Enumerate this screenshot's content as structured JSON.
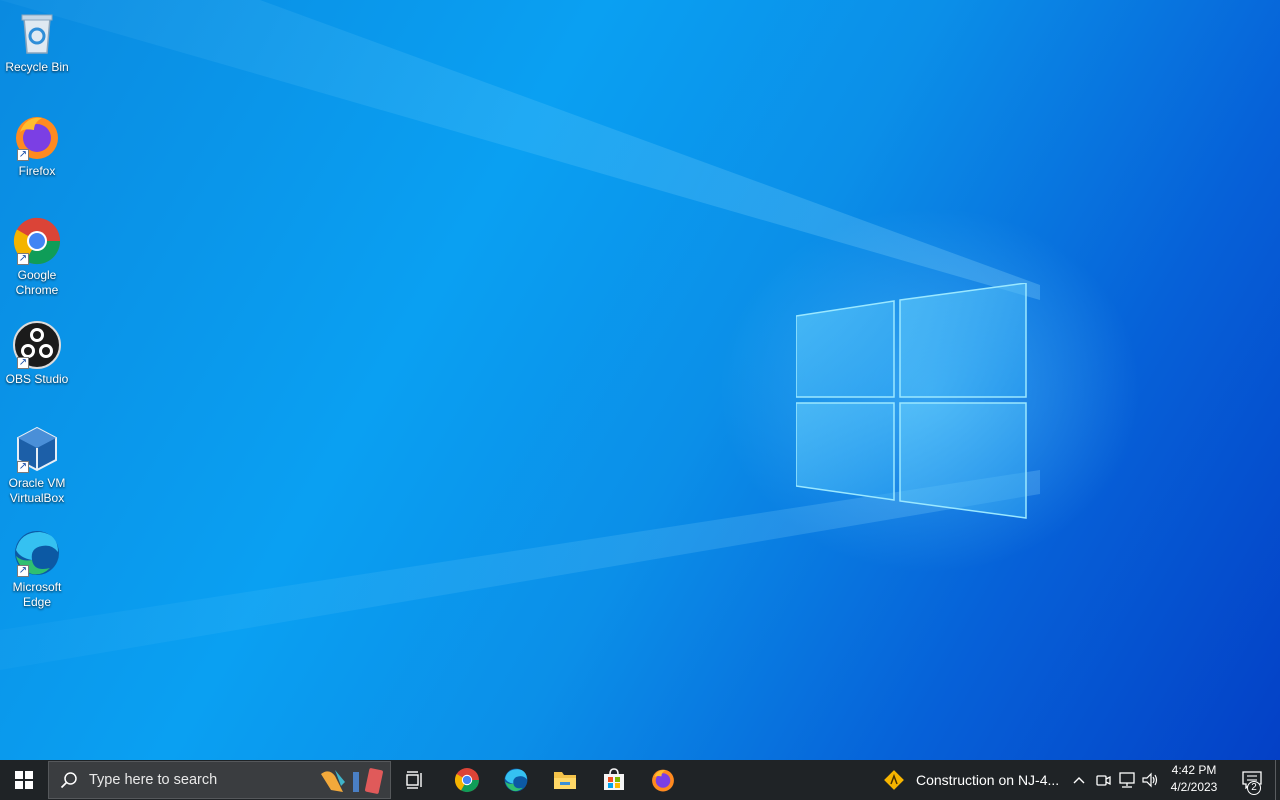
{
  "desktop": {
    "icons": [
      {
        "label": "Recycle Bin",
        "icon": "recycle-bin-icon",
        "shortcut": false
      },
      {
        "label": "Firefox",
        "icon": "firefox-icon",
        "shortcut": true
      },
      {
        "label": "Google\nChrome",
        "icon": "chrome-icon",
        "shortcut": true
      },
      {
        "label": "OBS Studio",
        "icon": "obs-studio-icon",
        "shortcut": true
      },
      {
        "label": "Oracle VM\nVirtualBox",
        "icon": "virtualbox-icon",
        "shortcut": true
      },
      {
        "label": "Microsoft\nEdge",
        "icon": "edge-icon",
        "shortcut": true
      }
    ]
  },
  "taskbar": {
    "start_icon": "windows-start-icon",
    "search": {
      "placeholder": "Type here to search",
      "icon": "search-icon"
    },
    "task_view_icon": "task-view-icon",
    "pinned": [
      {
        "name": "Google Chrome",
        "icon": "chrome-icon"
      },
      {
        "name": "Microsoft Edge",
        "icon": "edge-icon"
      },
      {
        "name": "File Explorer",
        "icon": "file-explorer-icon"
      },
      {
        "name": "Microsoft Store",
        "icon": "store-icon"
      },
      {
        "name": "Firefox",
        "icon": "firefox-icon"
      }
    ],
    "news": {
      "text": "Construction on NJ-4...",
      "icon": "traffic-warning-icon"
    },
    "tray": {
      "chevron_icon": "chevron-up-icon",
      "meet_icon": "meet-now-icon",
      "network_icon": "network-icon",
      "volume_icon": "volume-icon"
    },
    "clock": {
      "time": "4:42 PM",
      "date": "4/2/2023"
    },
    "notifications": {
      "count": "2",
      "icon": "action-center-icon"
    }
  },
  "colors": {
    "taskbar_bg": "#1f2326",
    "desktop_accent": "#0a8ae0"
  }
}
